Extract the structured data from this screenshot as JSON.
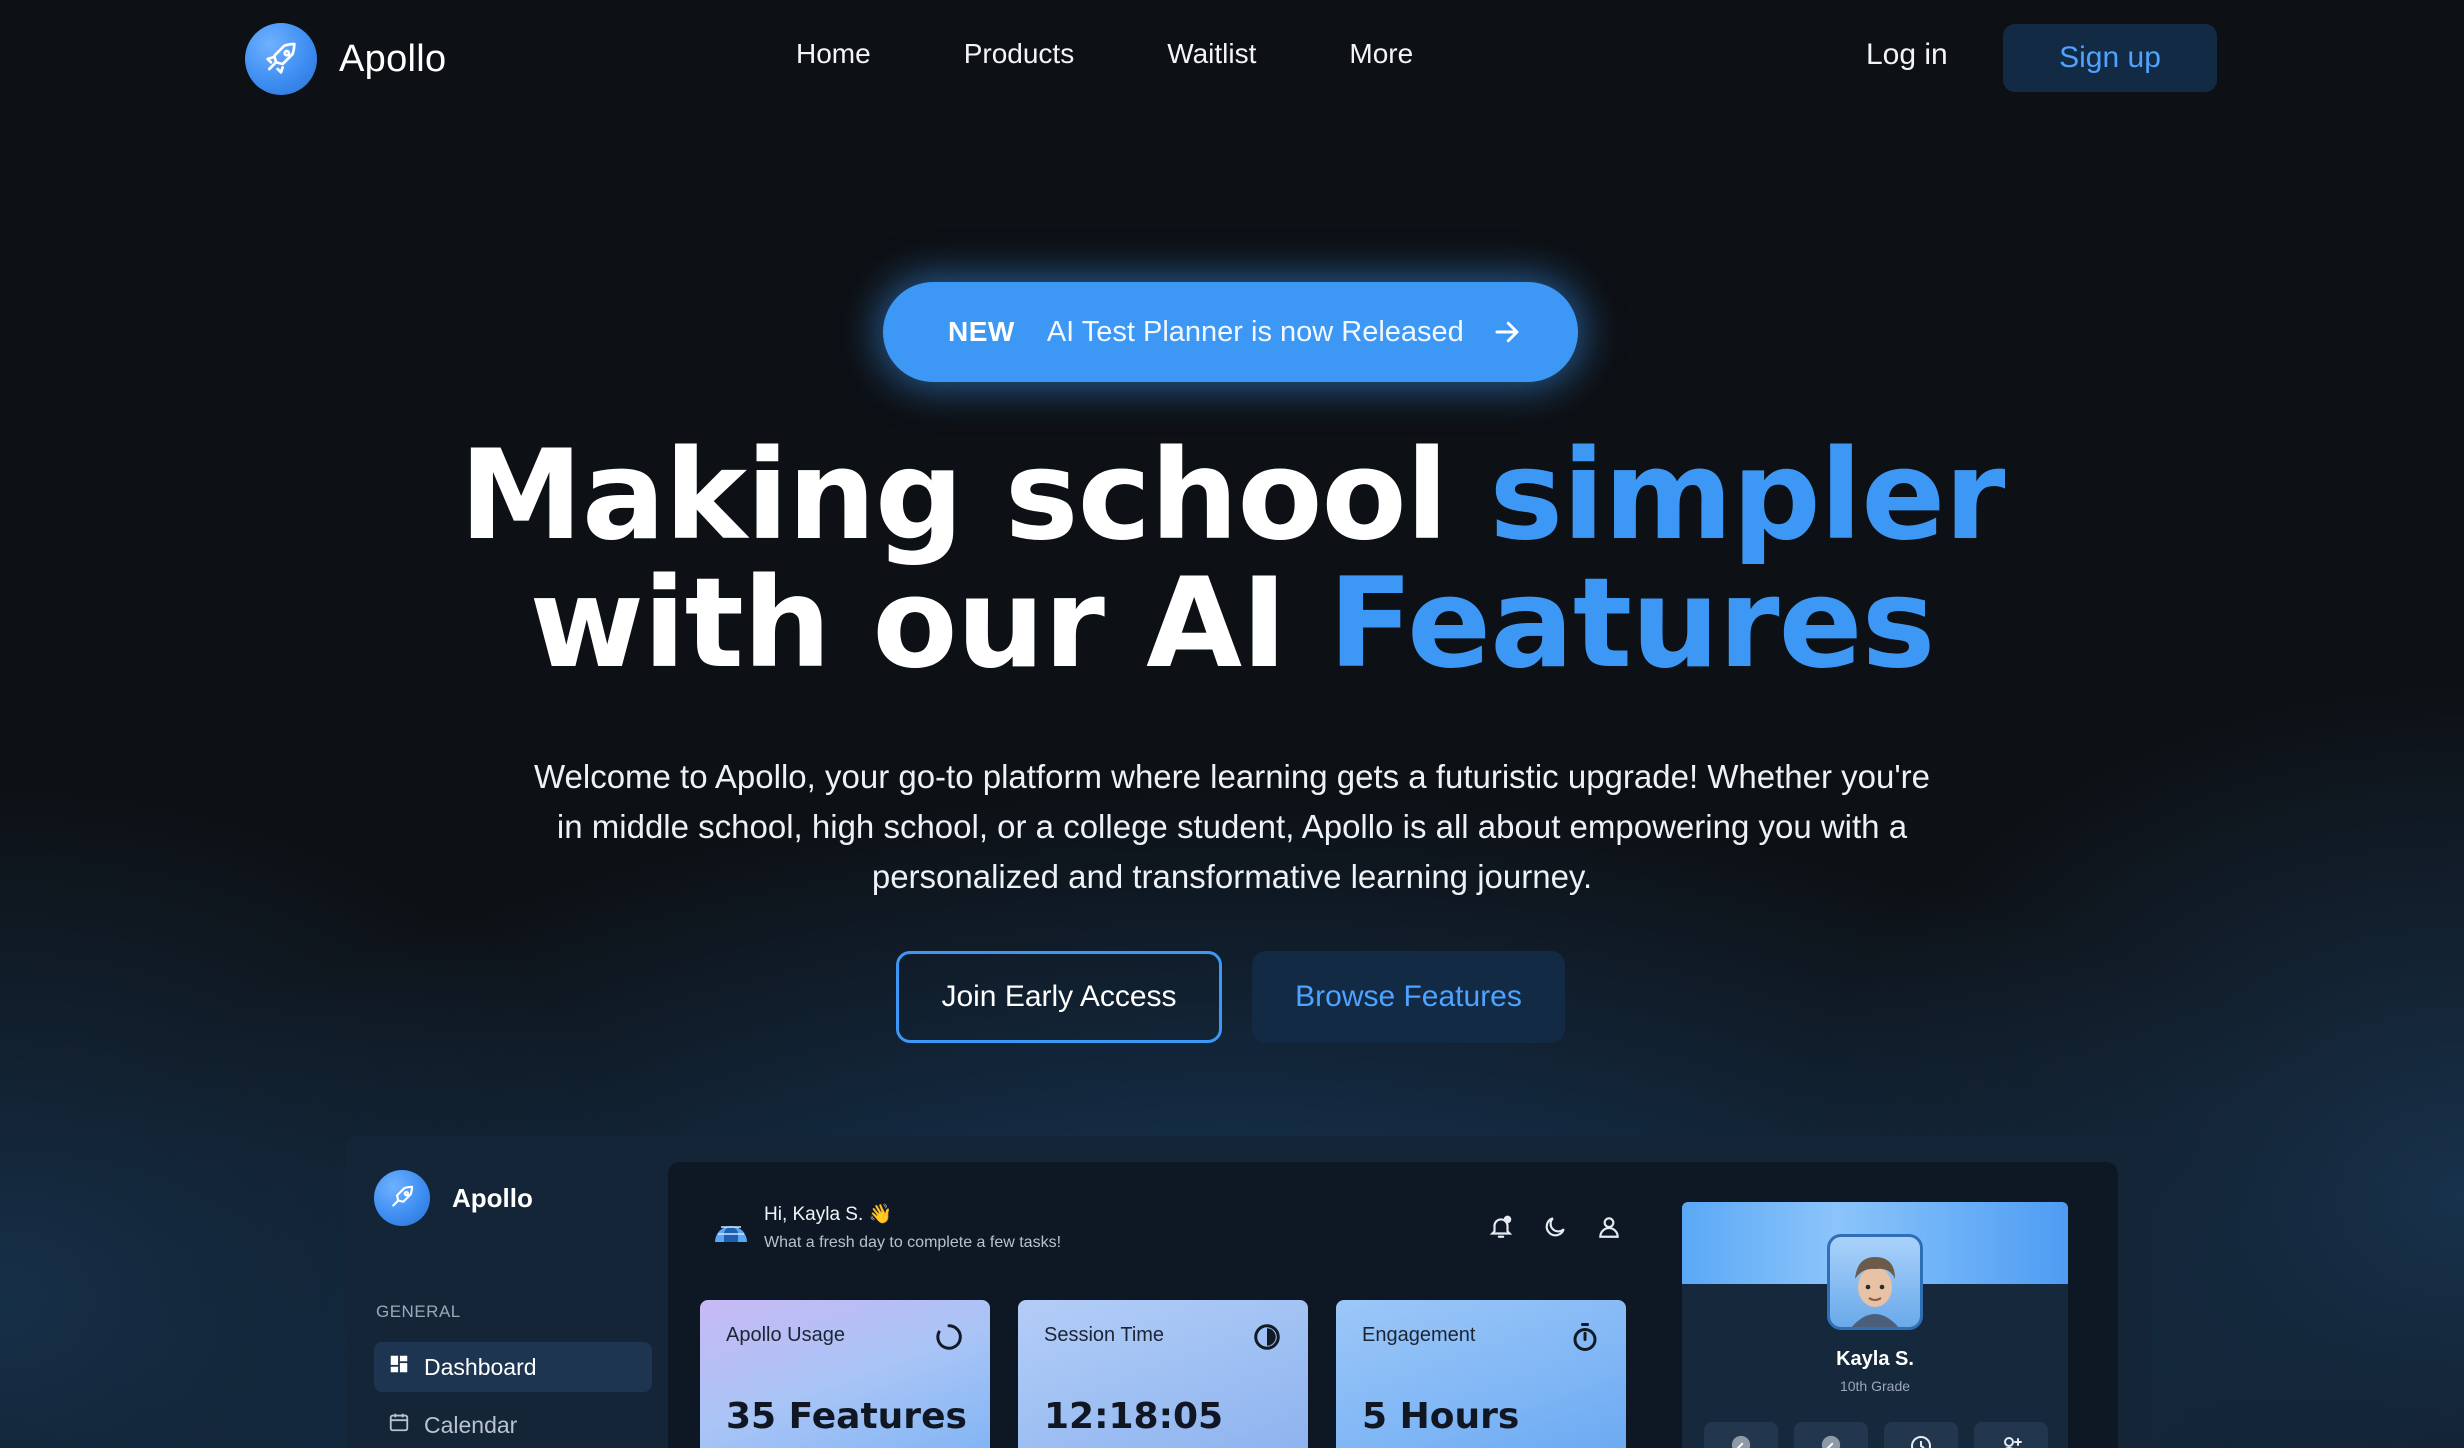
{
  "nav": {
    "brand": "Apollo",
    "links": [
      "Home",
      "Products",
      "Waitlist",
      "More"
    ],
    "login": "Log in",
    "signup": "Sign up"
  },
  "announcement": {
    "badge": "NEW",
    "text": "AI Test Planner is now Released"
  },
  "hero": {
    "headline_line1_white": "Making school ",
    "headline_line1_blue": "simpler",
    "headline_line2_white": "with our AI ",
    "headline_line2_blue": "Features",
    "subtext": "Welcome to Apollo, your go-to platform where learning gets a futuristic upgrade! Whether you're in middle school, high school, or a college student, Apollo is all about empowering you with a personalized and transformative learning journey.",
    "primary_cta": "Join Early Access",
    "secondary_cta": "Browse Features"
  },
  "preview": {
    "sidebar": {
      "brand": "Apollo",
      "section": "GENERAL",
      "items": [
        "Dashboard",
        "Calendar"
      ]
    },
    "greeting": {
      "title": "Hi, Kayla S. 👋",
      "subtitle": "What a fresh day to complete a few tasks!"
    },
    "cards": [
      {
        "label": "Apollo Usage",
        "value": "35 Features",
        "icon": "ring-loader-icon"
      },
      {
        "label": "Session Time",
        "value": "12:18:05",
        "icon": "half-moon-clock-icon"
      },
      {
        "label": "Engagement",
        "value": "5 Hours",
        "icon": "stopwatch-icon"
      }
    ],
    "profile": {
      "name": "Kayla S.",
      "grade": "10th Grade"
    }
  },
  "colors": {
    "accent": "#3d98f5",
    "background": "#0d1014",
    "button_dark": "#132a45",
    "link_blue": "#4da3ff"
  }
}
